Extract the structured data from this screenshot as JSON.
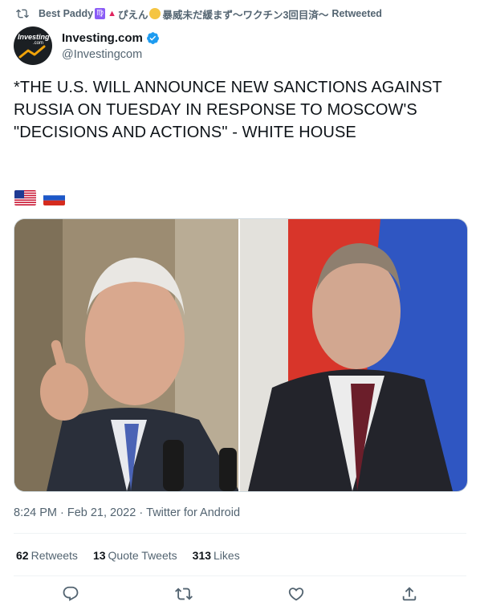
{
  "retweet_line": {
    "name_part1": "Best Paddy",
    "zodiac": "♍",
    "name_part2": "ぴえん",
    "name_part3": "暴威未だ緩まず〜ワクチン3回目済〜",
    "suffix": "Retweeted"
  },
  "author": {
    "display_name": "Investing.com",
    "handle": "@Investingcom",
    "avatar_text": "Investing",
    "avatar_sub": ".com"
  },
  "tweet": {
    "text": "*THE U.S. WILL ANNOUNCE NEW SANCTIONS AGAINST RUSSIA ON TUESDAY IN RESPONSE TO MOSCOW'S \"DECISIONS AND ACTIONS\" - WHITE HOUSE"
  },
  "flags": [
    {
      "name": "us-flag-icon"
    },
    {
      "name": "russia-flag-icon"
    }
  ],
  "meta": {
    "time": "8:24 PM",
    "date": "Feb 21, 2022",
    "source": "Twitter for Android"
  },
  "stats": {
    "retweets_count": "62",
    "retweets_label": "Retweets",
    "quotes_count": "13",
    "quotes_label": "Quote Tweets",
    "likes_count": "313",
    "likes_label": "Likes"
  },
  "colors": {
    "verified": "#1d9bf0",
    "secondary_text": "#536471",
    "primary_text": "#0f1419"
  }
}
